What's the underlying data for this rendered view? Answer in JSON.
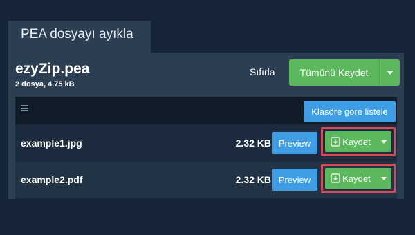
{
  "tab": {
    "label": "PEA dosyayı ayıkla"
  },
  "archive": {
    "name": "ezyZip.pea",
    "meta": "2 dosya, 4.75 kB"
  },
  "toolbar": {
    "reset_label": "Sıfırla",
    "save_all_label": "Tümünü Kaydet"
  },
  "list": {
    "folder_view_label": "Klasöre göre listele",
    "files": [
      {
        "name": "example1.jpg",
        "size": "2.32 KB",
        "preview_label": "Preview",
        "save_label": "Kaydet"
      },
      {
        "name": "example2.pdf",
        "size": "2.32 KB",
        "preview_label": "Preview",
        "save_label": "Kaydet"
      }
    ]
  },
  "icons": {
    "menu": "hamburger-icon",
    "download": "download-icon",
    "caret": "caret-down-icon"
  },
  "colors": {
    "background": "#162538",
    "panel": "#2b3e52",
    "primary_blue": "#3e9de4",
    "success_green": "#5cb85c",
    "highlight_red": "#d84a5b"
  }
}
